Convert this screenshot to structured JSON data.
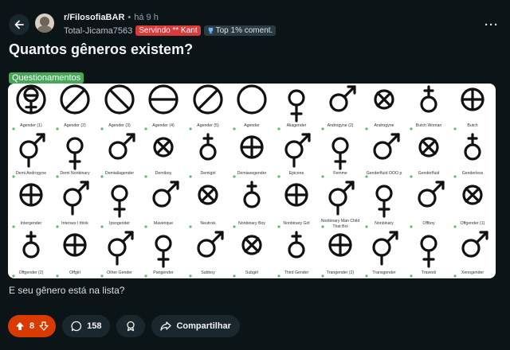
{
  "header": {
    "subreddit": "r/FilosofiaBAR",
    "separator": "•",
    "time_ago": "há 9 h",
    "username": "Total-Jicama7563",
    "user_flair": "Servindo ** Kant",
    "badge_label": "Top 1% coment."
  },
  "post": {
    "title": "Quantos gêneros existem?",
    "flair": "Questionamentos",
    "body": "E seu gênero está na lista?"
  },
  "image": {
    "labels": [
      [
        "Agender (1)",
        "Agender (2)",
        "Agender (3)",
        "Agender (4)",
        "Agender (5)",
        "Agender",
        "Aliagender",
        "Androgyne (2)",
        "Androgyne",
        "Butch Woman",
        "Butch"
      ],
      [
        "Demi Androgyne",
        "Demi Nonbinary",
        "Demialiagender",
        "Demiboy",
        "Demigirl",
        "Demiaxegender",
        "Epicene",
        "Femme",
        "Genderfluid OOO p",
        "Genderfluid",
        "Genderless"
      ],
      [
        "Intergender",
        "Intersex I think",
        "Ipsogender",
        "Maverique",
        "Neutrois",
        "Nonbinary Boy",
        "Nonbinary Girl",
        "Nonbinary Man Child That Boi",
        "Nonbinary",
        "Offboy",
        "Offgender (1)"
      ],
      [
        "Offgender (2)",
        "Offgirl",
        "Other Gender",
        "Pangender",
        "Subboy",
        "Subgirl",
        "Third Gender",
        "Trangender (2)",
        "Transgender",
        "Travesti",
        "Xenogender"
      ]
    ]
  },
  "actions": {
    "vote_count": "8",
    "comment_count": "158",
    "share_label": "Compartilhar"
  },
  "colors": {
    "background": "#0b1416",
    "vote": "#d93a00",
    "flair_red": "#d93a3a",
    "flair_green": "#46a758",
    "pill": "#1a282d"
  }
}
